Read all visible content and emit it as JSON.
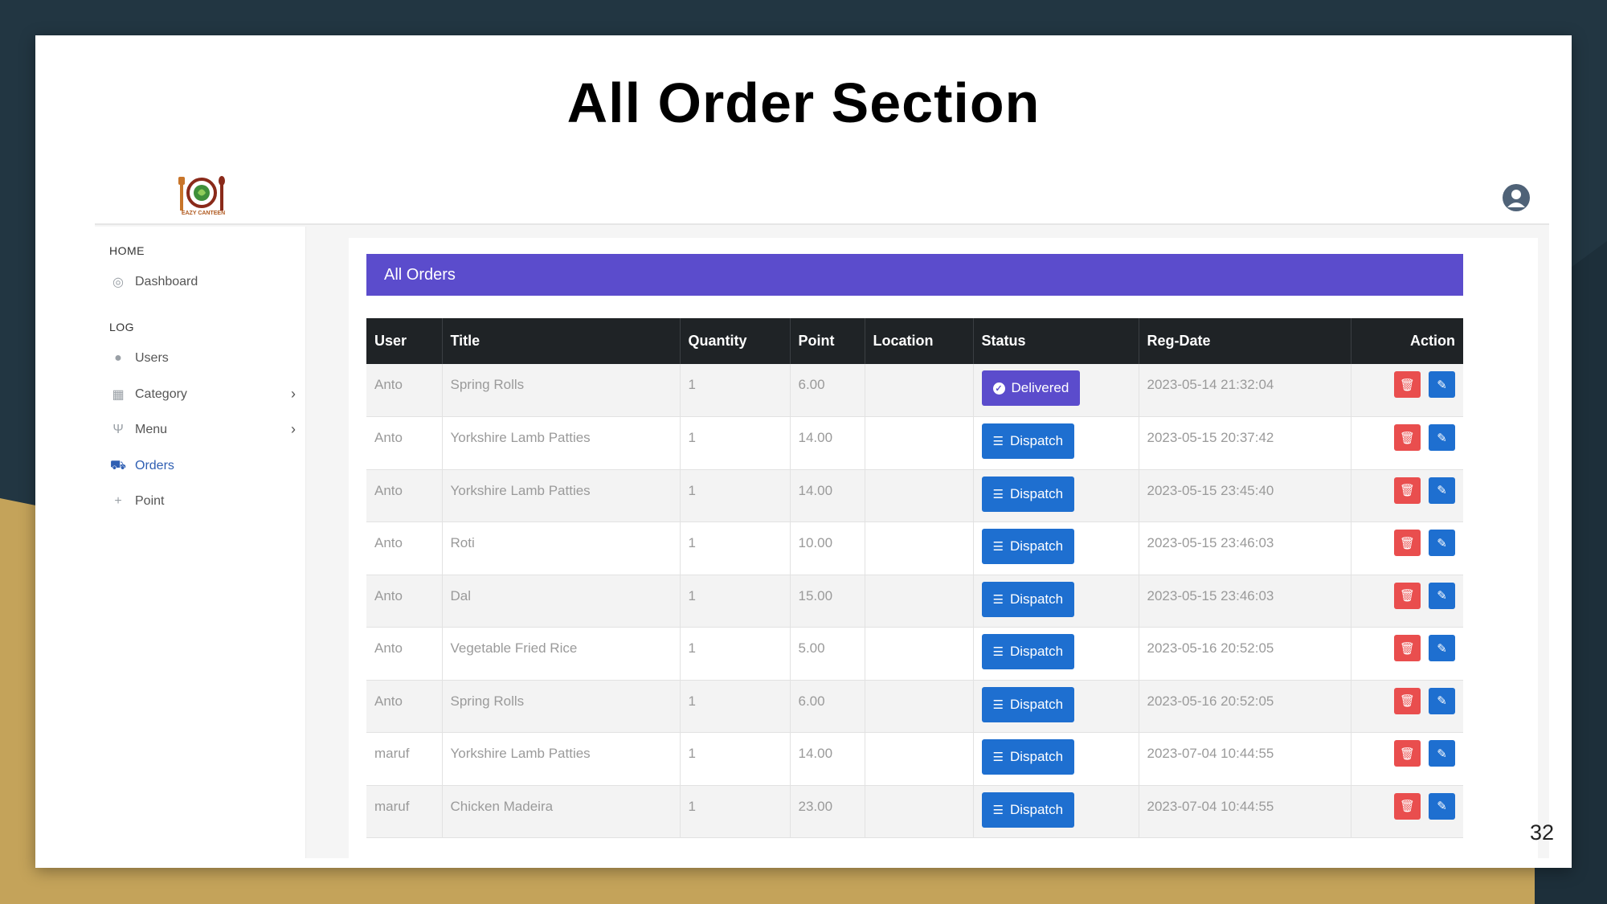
{
  "slide": {
    "title": "All Order Section",
    "page_number": "32"
  },
  "app": {
    "logo_text": "EAZY CANTEEN",
    "sidebar": {
      "sections": [
        {
          "label": "HOME"
        },
        {
          "label": "LOG"
        }
      ],
      "items": [
        {
          "label": "Dashboard",
          "icon": "dashboard-icon"
        },
        {
          "label": "Users",
          "icon": "user-icon"
        },
        {
          "label": "Category",
          "icon": "category-icon",
          "has_submenu": true
        },
        {
          "label": "Menu",
          "icon": "cutlery-icon",
          "has_submenu": true
        },
        {
          "label": "Orders",
          "icon": "cart-icon",
          "active": true
        },
        {
          "label": "Point",
          "icon": "plus-icon"
        }
      ]
    },
    "card_title": "All Orders",
    "table": {
      "columns": [
        "User",
        "Title",
        "Quantity",
        "Point",
        "Location",
        "Status",
        "Reg-Date",
        "Action"
      ],
      "rows": [
        {
          "user": "Anto",
          "title": "Spring Rolls",
          "quantity": "1",
          "point": "6.00",
          "location": "",
          "status": "Delivered",
          "reg_date": "2023-05-14 21:32:04"
        },
        {
          "user": "Anto",
          "title": "Yorkshire Lamb Patties",
          "quantity": "1",
          "point": "14.00",
          "location": "",
          "status": "Dispatch",
          "reg_date": "2023-05-15 20:37:42"
        },
        {
          "user": "Anto",
          "title": "Yorkshire Lamb Patties",
          "quantity": "1",
          "point": "14.00",
          "location": "",
          "status": "Dispatch",
          "reg_date": "2023-05-15 23:45:40"
        },
        {
          "user": "Anto",
          "title": "Roti",
          "quantity": "1",
          "point": "10.00",
          "location": "",
          "status": "Dispatch",
          "reg_date": "2023-05-15 23:46:03"
        },
        {
          "user": "Anto",
          "title": "Dal",
          "quantity": "1",
          "point": "15.00",
          "location": "",
          "status": "Dispatch",
          "reg_date": "2023-05-15 23:46:03"
        },
        {
          "user": "Anto",
          "title": "Vegetable Fried Rice",
          "quantity": "1",
          "point": "5.00",
          "location": "",
          "status": "Dispatch",
          "reg_date": "2023-05-16 20:52:05"
        },
        {
          "user": "Anto",
          "title": "Spring Rolls",
          "quantity": "1",
          "point": "6.00",
          "location": "",
          "status": "Dispatch",
          "reg_date": "2023-05-16 20:52:05"
        },
        {
          "user": "maruf",
          "title": "Yorkshire Lamb Patties",
          "quantity": "1",
          "point": "14.00",
          "location": "",
          "status": "Dispatch",
          "reg_date": "2023-07-04 10:44:55"
        },
        {
          "user": "maruf",
          "title": "Chicken Madeira",
          "quantity": "1",
          "point": "23.00",
          "location": "",
          "status": "Dispatch",
          "reg_date": "2023-07-04 10:44:55"
        }
      ]
    },
    "colors": {
      "header_bar": "#5b4ccc",
      "dispatch_button": "#1e6fd0",
      "delivered_button": "#5b4ccc",
      "delete_button": "#e94e4e",
      "edit_button": "#1e6fd0"
    }
  }
}
